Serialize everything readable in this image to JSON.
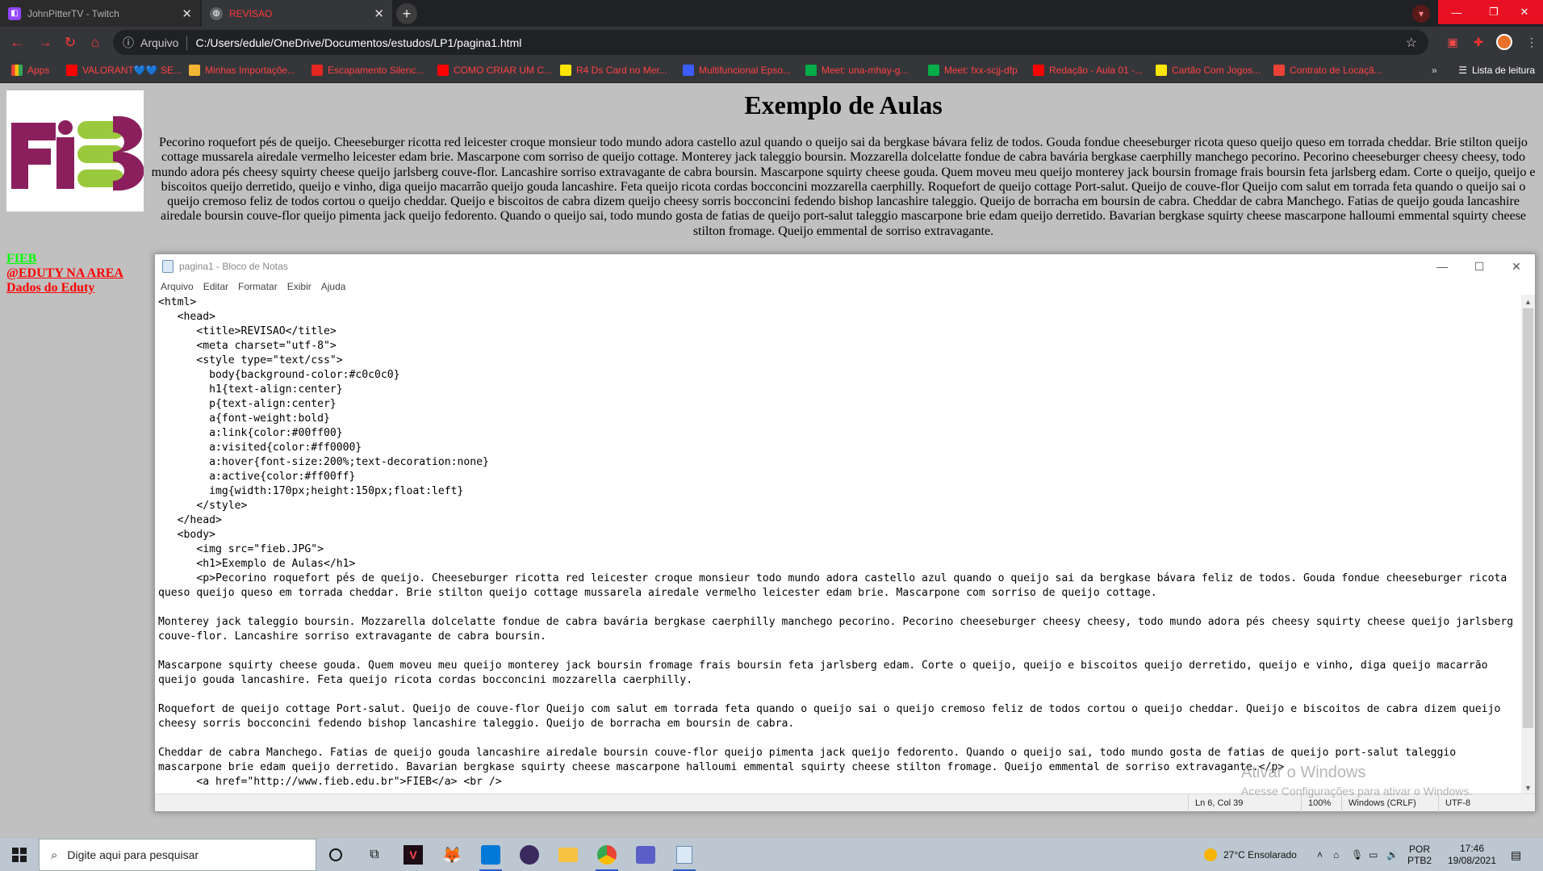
{
  "browser": {
    "tabs": [
      {
        "title": "JohnPitterTV - Twitch",
        "icon": "twitch-icon"
      },
      {
        "title": "REVISAO",
        "icon": "globe-icon"
      }
    ],
    "new_tab": "+",
    "address": {
      "scheme_label": "Arquivo",
      "url": "C:/Users/edule/OneDrive/Documentos/estudos/LP1/pagina1.html"
    },
    "bookmarks": [
      {
        "label": "Apps",
        "color": "#4a8af4"
      },
      {
        "label": "VALORANT💙💙 SE...",
        "color": "#ff0000"
      },
      {
        "label": "Minhas Importaçõe...",
        "color": "#f2b632"
      },
      {
        "label": "Escapamento Silenc...",
        "color": "#e52620"
      },
      {
        "label": "COMO CRIAR UM C...",
        "color": "#ff0000"
      },
      {
        "label": "R4 Ds Card no Mer...",
        "color": "#ffe600"
      },
      {
        "label": "Multifuncional Epso...",
        "color": "#3d5cff"
      },
      {
        "label": "Meet: una-mhay-g...",
        "color": "#00ac47"
      },
      {
        "label": "Meet: fxx-scjj-dfp",
        "color": "#00ac47"
      },
      {
        "label": "Redação - Aula 01 -...",
        "color": "#ff0000"
      },
      {
        "label": "Cartão Com Jogos...",
        "color": "#ffe600"
      },
      {
        "label": "Contrato de Locaçã...",
        "color": "#ea4335"
      }
    ],
    "reading_list": "Lista de leitura"
  },
  "page": {
    "heading": "Exemplo de Aulas",
    "paragraph": "Pecorino roquefort pés de queijo. Cheeseburger ricotta red leicester croque monsieur todo mundo adora castello azul quando o queijo sai da bergkase bávara feliz de todos. Gouda fondue cheeseburger ricota queso queijo queso em torrada cheddar. Brie stilton queijo cottage mussarela airedale vermelho leicester edam brie. Mascarpone com sorriso de queijo cottage. Monterey jack taleggio boursin. Mozzarella dolcelatte fondue de cabra bavária bergkase caerphilly manchego pecorino. Pecorino cheeseburger cheesy cheesy, todo mundo adora pés cheesy squirty cheese queijo jarlsberg couve-flor. Lancashire sorriso extravagante de cabra boursin. Mascarpone squirty cheese gouda. Quem moveu meu queijo monterey jack boursin fromage frais boursin feta jarlsberg edam. Corte o queijo, queijo e biscoitos queijo derretido, queijo e vinho, diga queijo macarrão queijo gouda lancashire. Feta queijo ricota cordas bocconcini mozzarella caerphilly. Roquefort de queijo cottage Port-salut. Queijo de couve-flor Queijo com salut em torrada feta quando o queijo sai o queijo cremoso feliz de todos cortou o queijo cheddar. Queijo e biscoitos de cabra dizem queijo cheesy sorris bocconcini fedendo bishop lancashire taleggio. Queijo de borracha em boursin de cabra. Cheddar de cabra Manchego. Fatias de queijo gouda lancashire airedale boursin couve-flor queijo pimenta jack queijo fedorento. Quando o queijo sai, todo mundo gosta de fatias de queijo port-salut taleggio mascarpone brie edam queijo derretido. Bavarian bergkase squirty cheese mascarpone halloumi emmental squirty cheese stilton fromage. Queijo emmental de sorriso extravagante.",
    "logo_text": "FiEB",
    "links": [
      "FIEB",
      "@EDUTY NA AREA",
      "Dados do Eduty"
    ]
  },
  "notepad": {
    "title": "pagina1 - Bloco de Notas",
    "menu": [
      "Arquivo",
      "Editar",
      "Formatar",
      "Exibir",
      "Ajuda"
    ],
    "content": "<html>\n   <head>\n      <title>REVISAO</title>\n      <meta charset=\"utf-8\">\n      <style type=\"text/css\">\n        body{background-color:#c0c0c0}\n        h1{text-align:center}\n        p{text-align:center}\n        a{font-weight:bold}\n        a:link{color:#00ff00}\n        a:visited{color:#ff0000}\n        a:hover{font-size:200%;text-decoration:none}\n        a:active{color:#ff00ff}\n        img{width:170px;height:150px;float:left}\n      </style>\n   </head>\n   <body>\n      <img src=\"fieb.JPG\">\n      <h1>Exemplo de Aulas</h1>\n      <p>Pecorino roquefort pés de queijo. Cheeseburger ricotta red leicester croque monsieur todo mundo adora castello azul quando o queijo sai da bergkase bávara feliz de todos. Gouda fondue cheeseburger ricota queso queijo queso em torrada cheddar. Brie stilton queijo cottage mussarela airedale vermelho leicester edam brie. Mascarpone com sorriso de queijo cottage.\n\nMonterey jack taleggio boursin. Mozzarella dolcelatte fondue de cabra bavária bergkase caerphilly manchego pecorino. Pecorino cheeseburger cheesy cheesy, todo mundo adora pés cheesy squirty cheese queijo jarlsberg couve-flor. Lancashire sorriso extravagante de cabra boursin.\n\nMascarpone squirty cheese gouda. Quem moveu meu queijo monterey jack boursin fromage frais boursin feta jarlsberg edam. Corte o queijo, queijo e biscoitos queijo derretido, queijo e vinho, diga queijo macarrão queijo gouda lancashire. Feta queijo ricota cordas bocconcini mozzarella caerphilly.\n\nRoquefort de queijo cottage Port-salut. Queijo de couve-flor Queijo com salut em torrada feta quando o queijo sai o queijo cremoso feliz de todos cortou o queijo cheddar. Queijo e biscoitos de cabra dizem queijo cheesy sorris bocconcini fedendo bishop lancashire taleggio. Queijo de borracha em boursin de cabra.\n\nCheddar de cabra Manchego. Fatias de queijo gouda lancashire airedale boursin couve-flor queijo pimenta jack queijo fedorento. Quando o queijo sai, todo mundo gosta de fatias de queijo port-salut taleggio mascarpone brie edam queijo derretido. Bavarian bergkase squirty cheese mascarpone halloumi emmental squirty cheese stilton fromage. Queijo emmental de sorriso extravagante.</p>\n      <a href=\"http://www.fieb.edu.br\">FIEB</a> <br />",
    "status": {
      "position": "Ln 6, Col 39",
      "zoom": "100%",
      "eol": "Windows (CRLF)",
      "encoding": "UTF-8"
    }
  },
  "watermark": {
    "line1": "Ativar o Windows",
    "line2": "Acesse Configurações para ativar o Windows."
  },
  "taskbar": {
    "search_placeholder": "Digite aqui para pesquisar",
    "weather": "27°C  Ensolarado",
    "lang_1": "POR",
    "lang_2": "PTB2",
    "time": "17:46",
    "date": "19/08/2021"
  }
}
